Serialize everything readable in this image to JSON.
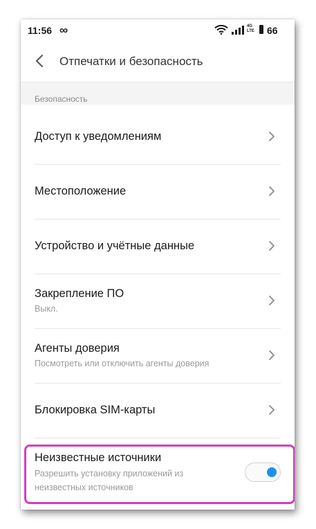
{
  "status_bar": {
    "time": "11:56",
    "infinity_glyph": "∞",
    "network_type": "4G\nLTE",
    "battery": "66",
    "wifi_icon": "wifi-icon",
    "signal_icon": "signal-icon"
  },
  "header": {
    "title": "Отпечатки и безопасность",
    "back_icon": "chevron-left-icon"
  },
  "section": {
    "label": "Безопасность"
  },
  "items": [
    {
      "label": "Доступ к уведомлениям",
      "sub": ""
    },
    {
      "label": "Местоположение",
      "sub": ""
    },
    {
      "label": "Устройство и учётные данные",
      "sub": ""
    },
    {
      "label": "Закрепление ПО",
      "sub": "Выкл."
    },
    {
      "label": "Агенты доверия",
      "sub": "Посмотреть или отключить агенты доверия"
    },
    {
      "label": "Блокировка SIM-карты",
      "sub": ""
    }
  ],
  "unknown_sources": {
    "label": "Неизвестные источники",
    "sub_line1": "Разрешить установку приложений из",
    "sub_line2": "неизвестных источников",
    "enabled": true
  },
  "colors": {
    "toggle_on": "#1e90f0",
    "highlight": "#d63cc3"
  }
}
